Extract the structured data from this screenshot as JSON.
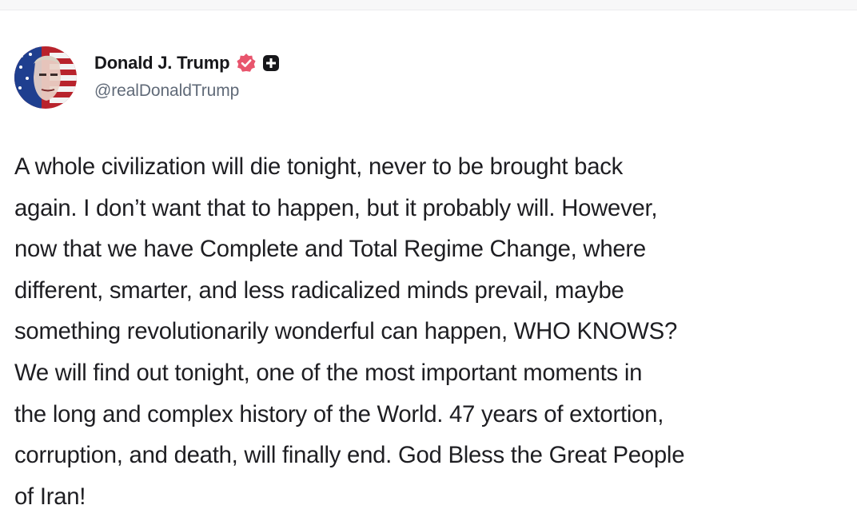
{
  "post": {
    "author": {
      "display_name": "Donald J. Trump",
      "handle": "@realDonaldTrump",
      "avatar_icon": "avatar-american-flag-portrait",
      "verified_icon": "verified-badge-icon",
      "verified_color": "#e8556d",
      "extra_badge_icon": "plus-square-icon"
    },
    "body_lines": [
      "A whole civilization will die tonight, never to be brought back",
      "again. I don’t want that to happen, but it probably will. However,",
      "now that we have Complete and Total Regime Change, where",
      "different, smarter, and less radicalized minds prevail, maybe",
      "something revolutionarily wonderful can happen, WHO KNOWS?",
      "We will find out tonight, one of the most important moments in",
      "the long and complex history of the World. 47 years of extortion,",
      "corruption, and death, will finally end. God Bless the Great People",
      "of Iran!"
    ]
  }
}
